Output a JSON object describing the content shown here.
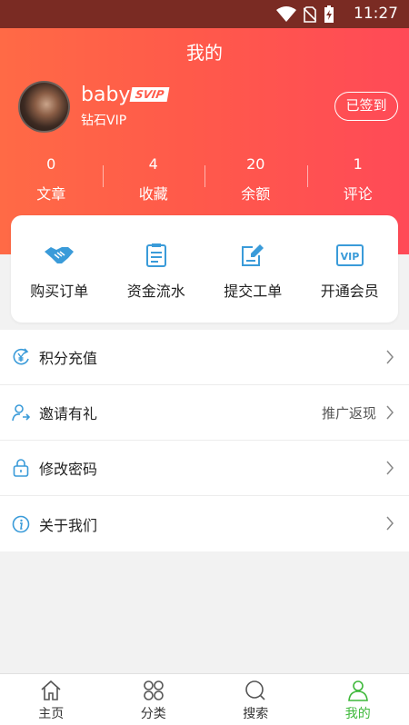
{
  "status_bar": {
    "time": "11:27",
    "icons": [
      "wifi-icon",
      "no-sim-icon",
      "battery-charging-icon"
    ]
  },
  "page": {
    "title": "我的"
  },
  "profile": {
    "username": "baby",
    "badge": "SVIP",
    "level": "钻石VIP",
    "signin_label": "已签到"
  },
  "stats": [
    {
      "value": "0",
      "label": "文章"
    },
    {
      "value": "4",
      "label": "收藏"
    },
    {
      "value": "20",
      "label": "余额"
    },
    {
      "value": "1",
      "label": "评论"
    }
  ],
  "quick_actions": [
    {
      "label": "购买订单",
      "icon": "handshake-icon"
    },
    {
      "label": "资金流水",
      "icon": "ledger-icon"
    },
    {
      "label": "提交工单",
      "icon": "edit-ticket-icon"
    },
    {
      "label": "开通会员",
      "icon": "vip-icon"
    }
  ],
  "menu": [
    {
      "label": "积分充值",
      "extra": "",
      "icon": "yen-refresh-icon"
    },
    {
      "label": "邀请有礼",
      "extra": "推广返现",
      "icon": "invite-user-icon"
    },
    {
      "label": "修改密码",
      "extra": "",
      "icon": "lock-icon"
    },
    {
      "label": "关于我们",
      "extra": "",
      "icon": "info-icon"
    }
  ],
  "bottom_nav": [
    {
      "label": "主页",
      "icon": "home-icon"
    },
    {
      "label": "分类",
      "icon": "category-icon"
    },
    {
      "label": "搜索",
      "icon": "search-icon"
    },
    {
      "label": "我的",
      "icon": "user-icon",
      "active": true
    }
  ],
  "colors": {
    "header_gradient_start": "#ff6a46",
    "header_gradient_end": "#ff4a57",
    "icon_blue": "#3a9bd9",
    "active_green": "#3eb83a"
  }
}
